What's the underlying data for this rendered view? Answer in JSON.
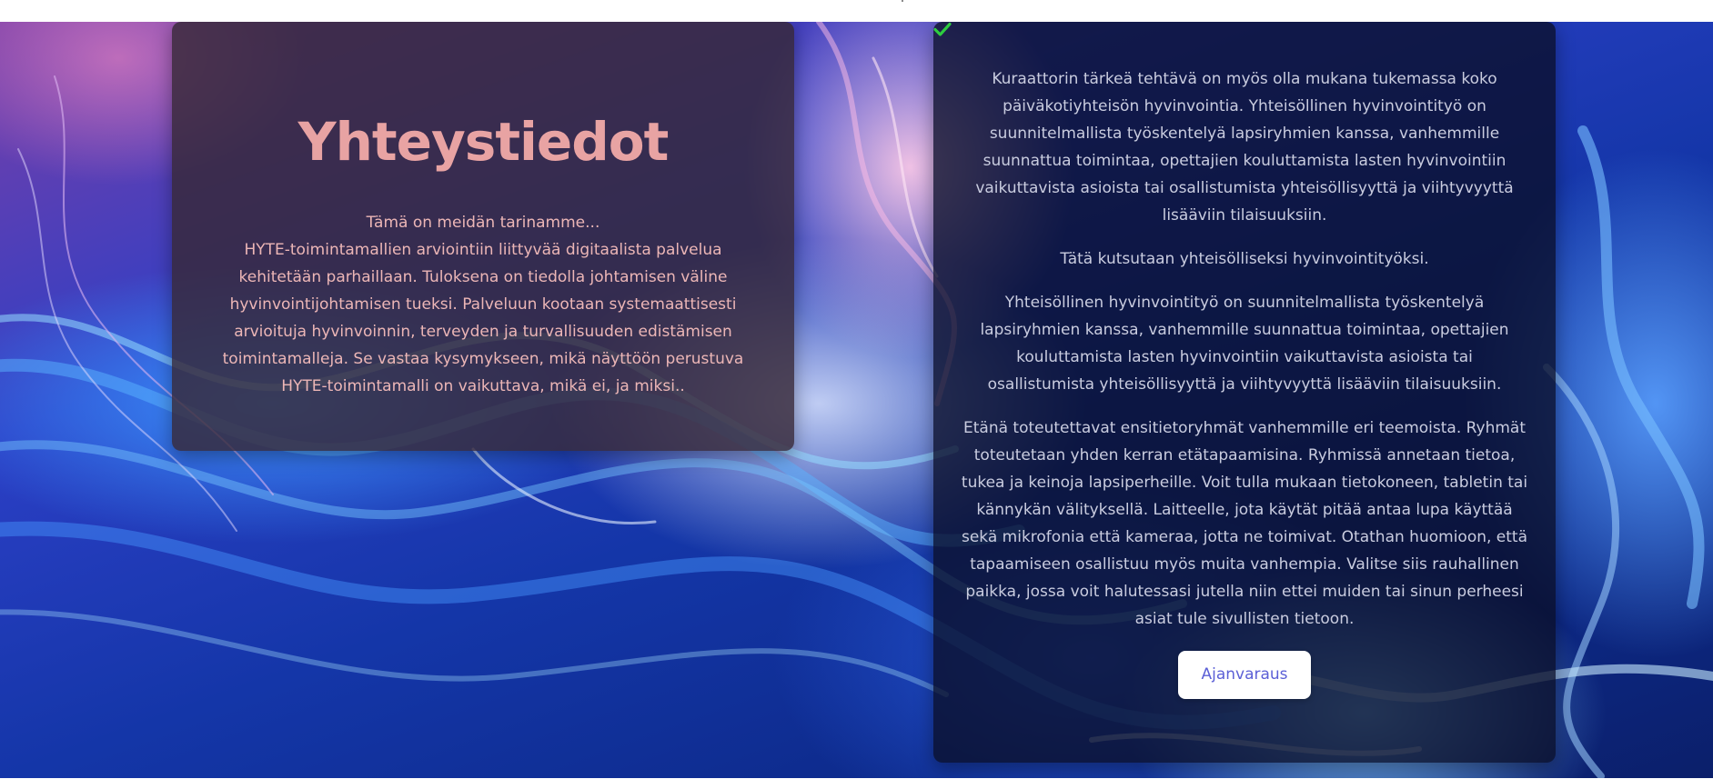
{
  "contact": {
    "title": "Yhteystiedot",
    "intro_line": "Tämä on meidän tarinamme...",
    "intro_text": "HYTE-toimintamallien arviointiin liittyvää digitaalista palvelua kehitetään parhaillaan. Tuloksena on tiedolla johtamisen väline hyvinvointijohtamisen tueksi. Palveluun kootaan systemaattisesti arvioituja hyvinvoinnin, terveyden ja turvallisuuden edistämisen toimintamalleja. Se vastaa kysymykseen, mikä näyttöön perustuva HYTE-toimintamalli on vaikuttava, mikä ei, ja miksi.."
  },
  "info": {
    "paragraph1": "Kuraattorin tärkeä tehtävä on myös olla mukana tukemassa koko päiväkotiyhteisön hyvinvointia. Yhteisöllinen hyvinvointityö on suunnitelmallista työskentelyä lapsiryhmien kanssa, vanhemmille suunnattua toimintaa, opettajien kouluttamista lasten hyvinvointiin vaikuttavista asioista tai osallistumista yhteisöllisyyttä ja viihtyvyyttä lisääviin tilaisuuksiin.",
    "paragraph2": "Tätä kutsutaan yhteisölliseksi hyvinvointityöksi.",
    "paragraph3": "Yhteisöllinen hyvinvointityö on suunnitelmallista työskentelyä lapsiryhmien kanssa, vanhemmille suunnattua toimintaa, opettajien kouluttamista lasten hyvinvointiin vaikuttavista asioista tai osallistumista yhteisöllisyyttä ja viihtyvyyttä lisääviin tilaisuuksiin.",
    "paragraph4": "Etänä toteutettavat ensitietoryhmät vanhemmille eri teemoista. Ryhmät toteutetaan yhden kerran etätapaamisina. Ryhmissä annetaan tietoa, tukea ja keinoja lapsiperheille. Voit tulla mukaan tietokoneen, tabletin tai kännykän välityksellä. Laitteelle, jota käytät pitää antaa lupa käyttää sekä mikrofonia että kameraa, jotta ne toimivat. Otathan huomioon, että tapaamiseen osallistuu myös muita vanhempia. Valitse siis rauhallinen paikka, jossa voit halutessasi jutella niin ettei muiden tai sinun perheesi asiat tule sivullisten tietoon.",
    "button_label": "Ajanvaraus"
  },
  "colors": {
    "title": "#e8a3a3",
    "check": "#2ecc40",
    "button_text": "#5b5fd6"
  },
  "icons": {
    "check": "check-icon"
  }
}
